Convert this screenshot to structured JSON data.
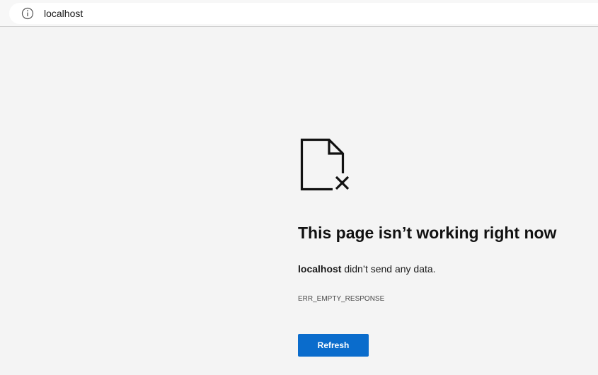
{
  "address_bar": {
    "url": "localhost",
    "icon": "info-icon"
  },
  "error_page": {
    "icon": "broken-document-icon",
    "heading": "This page isn’t working right now",
    "message_host": "localhost",
    "message_rest": " didn’t send any data.",
    "error_code": "ERR_EMPTY_RESPONSE",
    "refresh_label": "Refresh"
  },
  "colors": {
    "background": "#f4f4f4",
    "button": "#0a6ccc",
    "button_text": "#ffffff"
  }
}
